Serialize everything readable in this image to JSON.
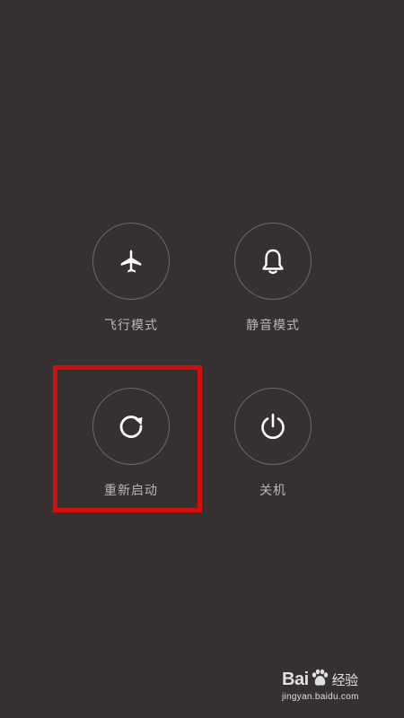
{
  "power_menu": {
    "items": [
      {
        "label": "飞行模式",
        "icon": "airplane-icon"
      },
      {
        "label": "静音模式",
        "icon": "bell-icon"
      },
      {
        "label": "重新启动",
        "icon": "restart-icon"
      },
      {
        "label": "关机",
        "icon": "power-icon"
      }
    ]
  },
  "annotation": {
    "highlight_color": "#d40d0d",
    "highlighted_item": "重新启动"
  },
  "watermark": {
    "brand_left": "Bai",
    "brand_right": "经验",
    "domain": "jingyan.baidu.com"
  },
  "colors": {
    "background": "#353131",
    "label": "#b9b7b6",
    "icon": "#ffffff"
  }
}
